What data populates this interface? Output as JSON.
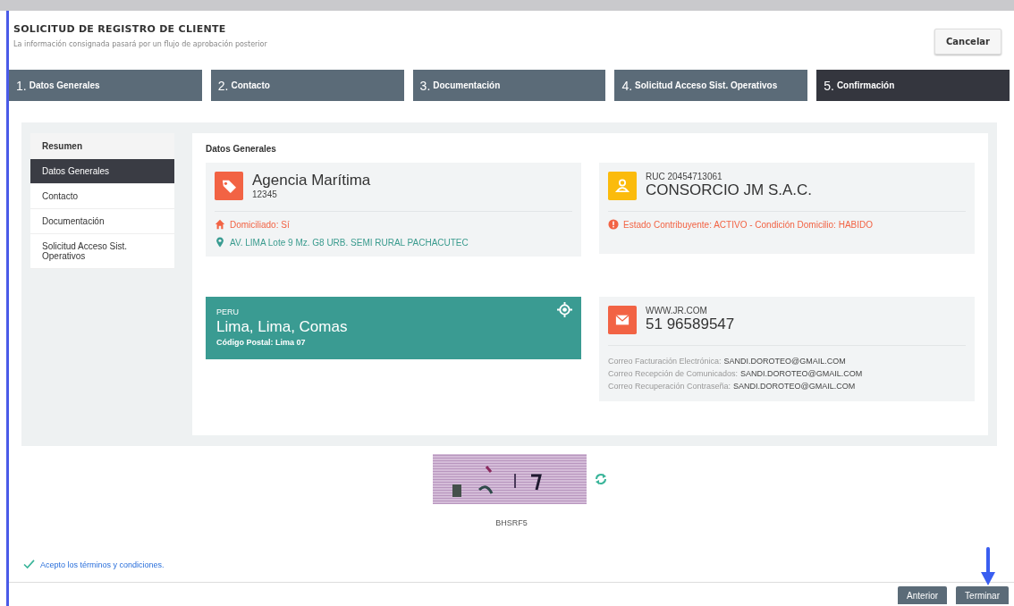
{
  "header": {
    "title": "SOLICITUD DE REGISTRO DE CLIENTE",
    "subtitle": "La información consignada pasará por un flujo de aprobación posterior",
    "cancel_button": "Cancelar"
  },
  "steps": [
    {
      "number": "1.",
      "label": "Datos Generales",
      "selected": false
    },
    {
      "number": "2.",
      "label": "Contacto",
      "selected": false
    },
    {
      "number": "3.",
      "label": "Documentación",
      "selected": false
    },
    {
      "number": "4.",
      "label": "Solicitud Acceso Sist. Operativos",
      "selected": false
    },
    {
      "number": "5.",
      "label": "Confirmación",
      "selected": true
    }
  ],
  "sidebar": {
    "title": "Resumen",
    "items": [
      {
        "label": "Datos Generales",
        "selected": true
      },
      {
        "label": "Contacto",
        "selected": false
      },
      {
        "label": "Documentación",
        "selected": false
      },
      {
        "label": "Solicitud Acceso Sist. Operativos",
        "selected": false
      }
    ]
  },
  "section_title": "Datos Generales",
  "agency_card": {
    "name": "Agencia Marítima",
    "code": "12345",
    "domiciled": "Domiciliado: Sí",
    "address": "AV. LIMA Lote 9 Mz. G8 URB. SEMI RURAL PACHACUTEC"
  },
  "company_card": {
    "ruc": "RUC 20454713061",
    "name": "CONSORCIO JM S.A.C.",
    "status": "Estado Contribuyente: ACTIVO - Condición Domicilio: HABIDO"
  },
  "location_card": {
    "country": "PERU",
    "place": "Lima, Lima, Comas",
    "postal": "Código Postal: Lima 07"
  },
  "contact_card": {
    "web": "WWW.JR.COM",
    "phone": "51 96589547",
    "emails": [
      {
        "label": "Correo Facturación Electrónica:",
        "value": "SANDI.DOROTEO@GMAIL.COM"
      },
      {
        "label": "Correo Recepción de Comunicados:",
        "value": "SANDI.DOROTEO@GMAIL.COM"
      },
      {
        "label": "Correo Recuperación Contraseña:",
        "value": "SANDI.DOROTEO@GMAIL.COM"
      }
    ]
  },
  "captcha": {
    "code": "BHSRF5"
  },
  "terms": {
    "label": "Acepto los términos y condiciones.",
    "checked": true
  },
  "buttons": [
    "Anterior",
    "Terminar"
  ]
}
